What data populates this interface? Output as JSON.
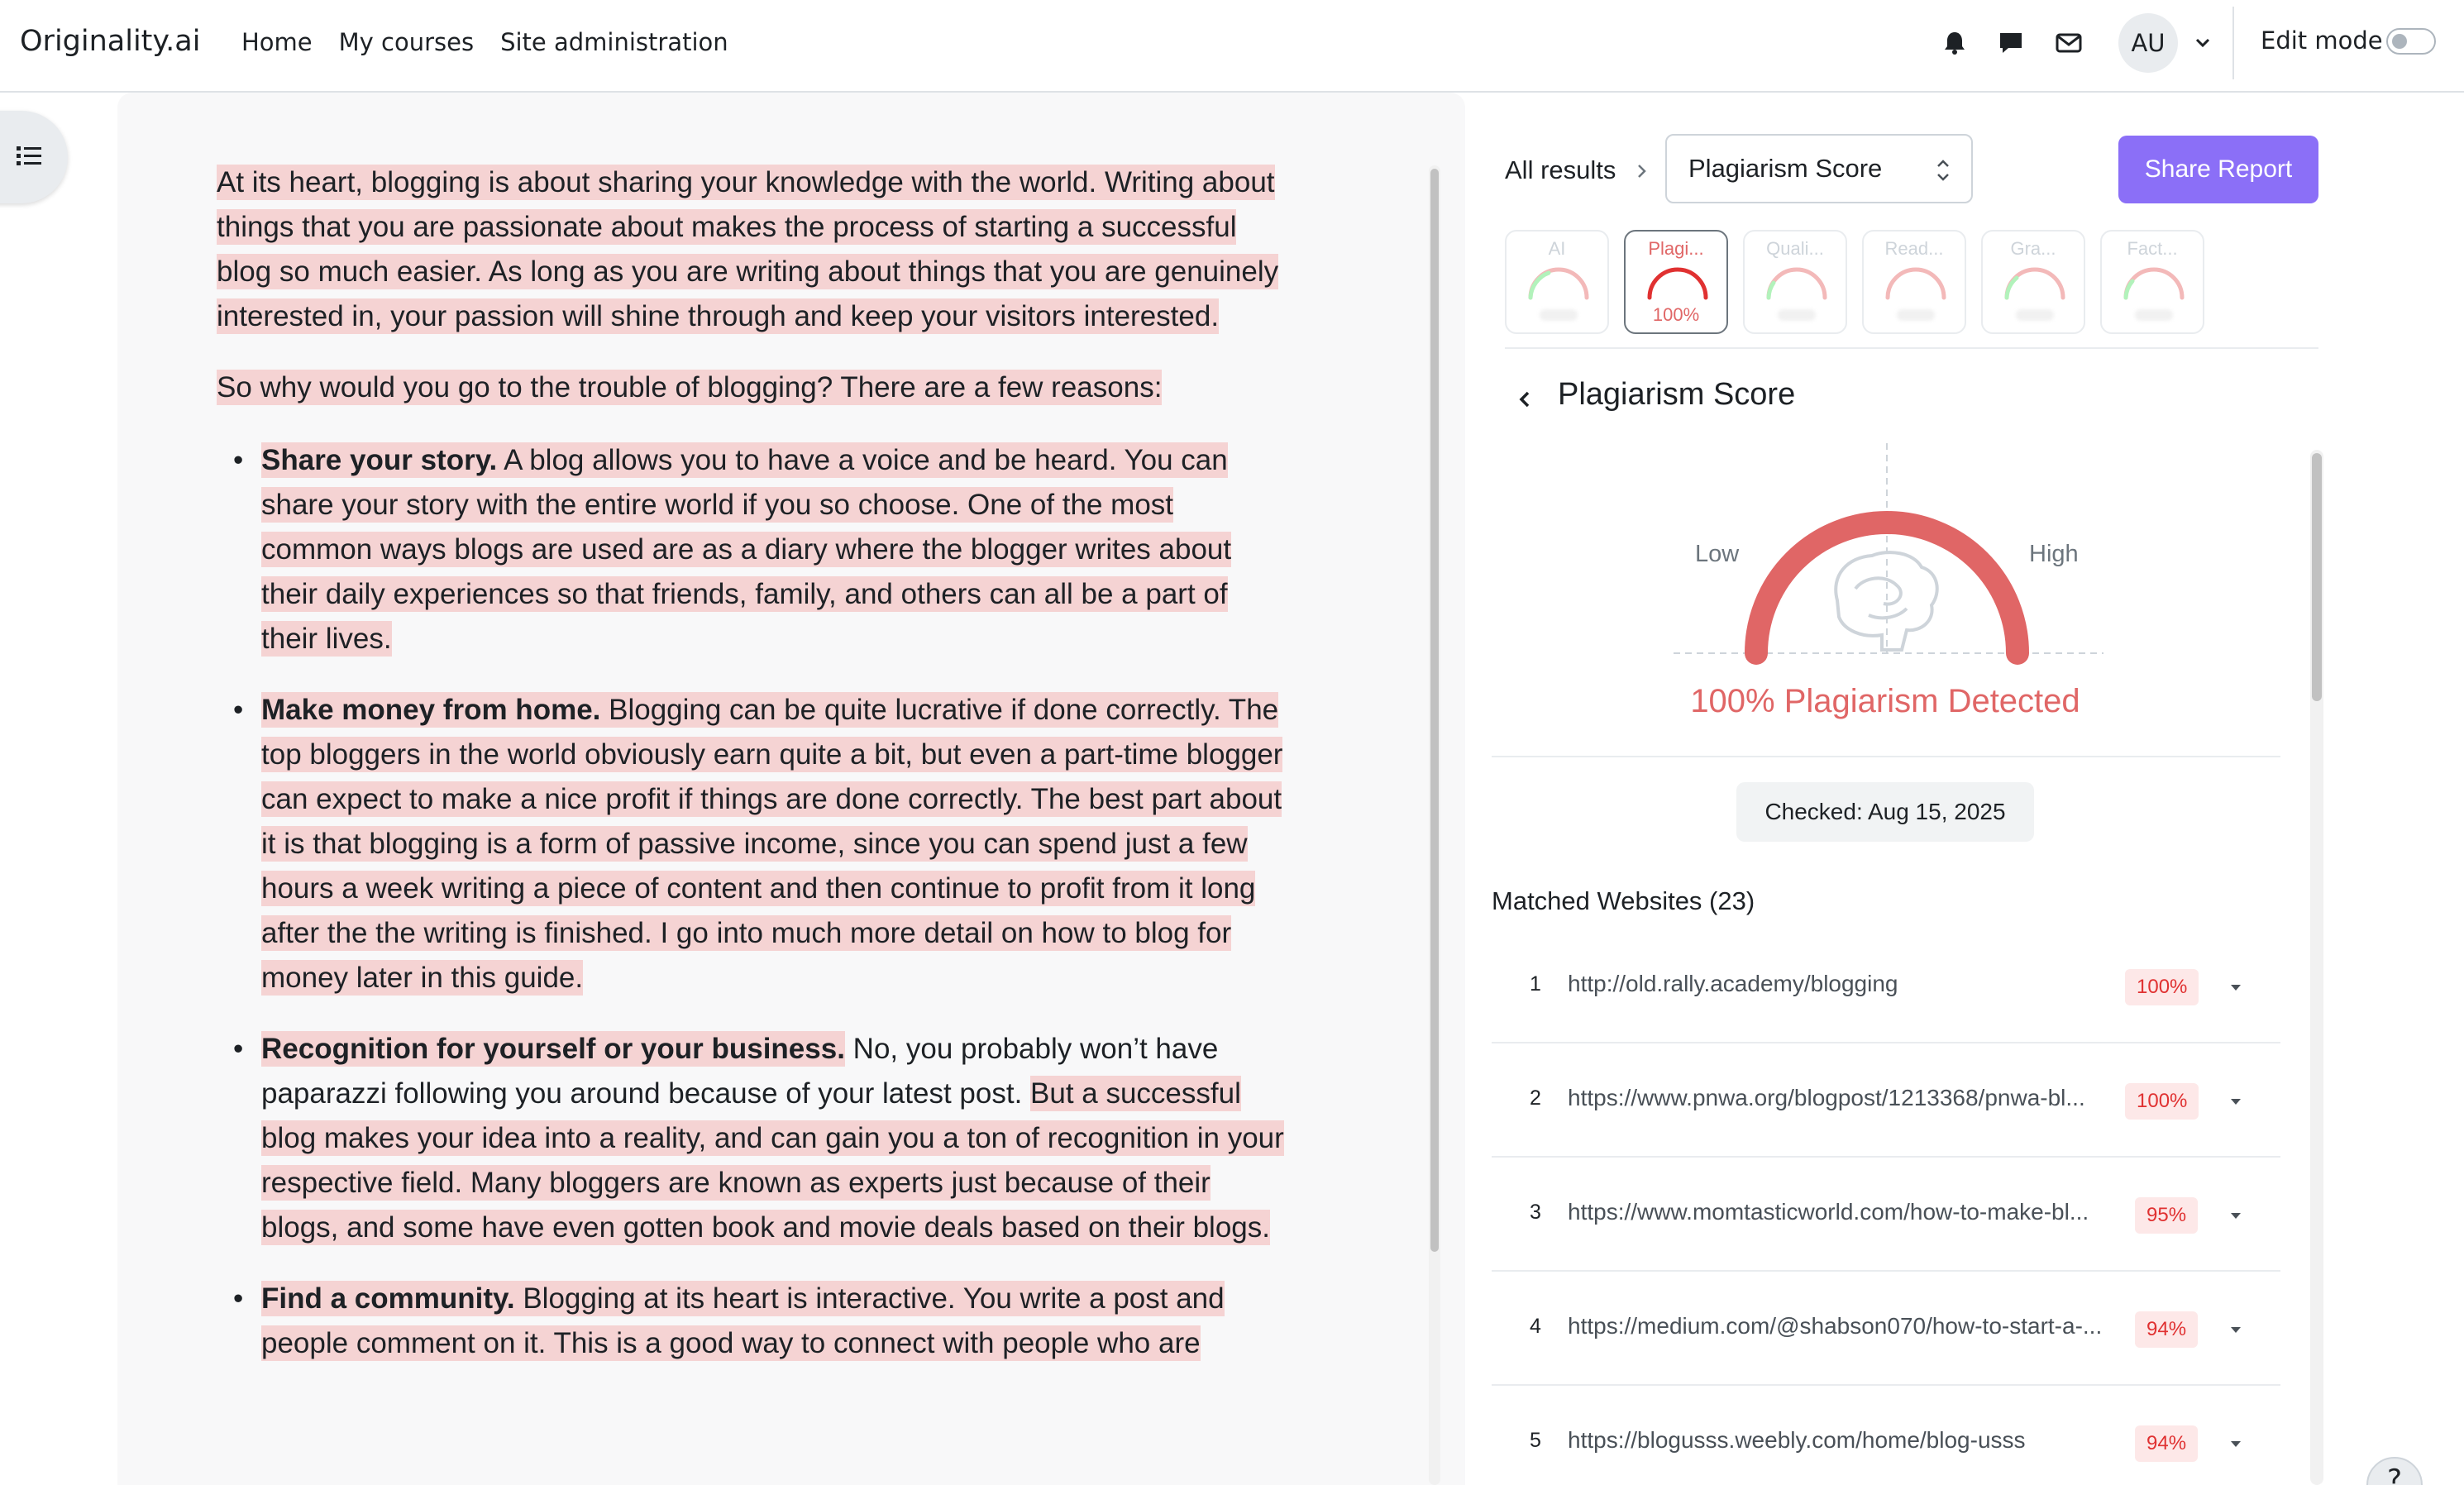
{
  "navbar": {
    "brand": "Originality.ai",
    "links": [
      "Home",
      "My courses",
      "Site administration"
    ],
    "avatar_initials": "AU",
    "edit_mode_label": "Edit mode",
    "icons": [
      "bell-icon",
      "chat-icon",
      "envelope-icon",
      "chevron-down-icon"
    ]
  },
  "document": {
    "paragraph1": "At its heart, blogging is about sharing your knowledge with the world. Writing about things that you are passionate about makes the process of starting a successful blog so much easier. As long as you are writing about things that you are genuinely interested in, your passion will shine through and keep your visitors interested.",
    "paragraph2": "So why would you go to the trouble of blogging? There are a few reasons:",
    "items": [
      {
        "title": "Share your story.",
        "text": " A blog allows you to have a voice and be heard. You can share your story with the entire world if you so choose. One of the most common ways blogs are used are as a diary where the blogger writes about their daily experiences so that friends, family, and others can all be a part of their lives."
      },
      {
        "title": "Make money from home.",
        "text": " Blogging can be quite lucrative if done correctly. The top bloggers in the world obviously earn quite a bit, but even a part-time blogger can expect to make a nice profit if things are done correctly. The best part about it is that blogging is a form of passive income, since you can spend just a few hours a week writing a piece of content and then continue to profit from it long after the the writing is finished. I go into much more detail on how to blog for money later in this guide."
      },
      {
        "title": "Recognition for yourself or your business.",
        "text_plain": " No, you probably won’t have paparazzi following you around because of your latest post. ",
        "text": "But a successful blog makes your idea into a reality, and can gain you a ton of recognition in your respective field. Many bloggers are known as experts just because of their blogs, and some have even gotten book and movie deals based on their blogs."
      },
      {
        "title": "Find a community.",
        "text": " Blogging at its heart is interactive. You write a post and people comment on it. This is a good way to connect with people who are"
      }
    ]
  },
  "results": {
    "breadcrumb": "All results",
    "selected_report": "Plagiarism Score",
    "share_label": "Share Report",
    "score_tabs": [
      {
        "label": "AI",
        "value": "",
        "active": false
      },
      {
        "label": "Plagi...",
        "value": "100%",
        "active": true
      },
      {
        "label": "Quali...",
        "value": "",
        "active": false
      },
      {
        "label": "Read...",
        "value": "",
        "active": false
      },
      {
        "label": "Gra...",
        "value": "",
        "active": false
      },
      {
        "label": "Fact...",
        "value": "",
        "active": false
      }
    ],
    "section_title": "Plagiarism Score",
    "gauge": {
      "low_label": "Low",
      "high_label": "High",
      "value_percent": 100,
      "color": "#e06666"
    },
    "detected_text": "100% Plagiarism Detected",
    "checked_text": "Checked: Aug 15, 2025",
    "matched_title": "Matched Websites (23)",
    "matches": [
      {
        "num": "1",
        "url": "http://old.rally.academy/blogging",
        "pct": "100%"
      },
      {
        "num": "2",
        "url": "https://www.pnwa.org/blogpost/1213368/pnwa-bl...",
        "pct": "100%"
      },
      {
        "num": "3",
        "url": "https://www.momtasticworld.com/how-to-make-bl...",
        "pct": "95%"
      },
      {
        "num": "4",
        "url": "https://medium.com/@shabson070/how-to-start-a-...",
        "pct": "94%"
      },
      {
        "num": "5",
        "url": "https://blogusss.weebly.com/home/blog-usss",
        "pct": "94%"
      }
    ]
  },
  "colors": {
    "accent": "#8b6ff7",
    "highlight": "#f5d3d3",
    "danger": "#e06666"
  },
  "help_label": "?"
}
